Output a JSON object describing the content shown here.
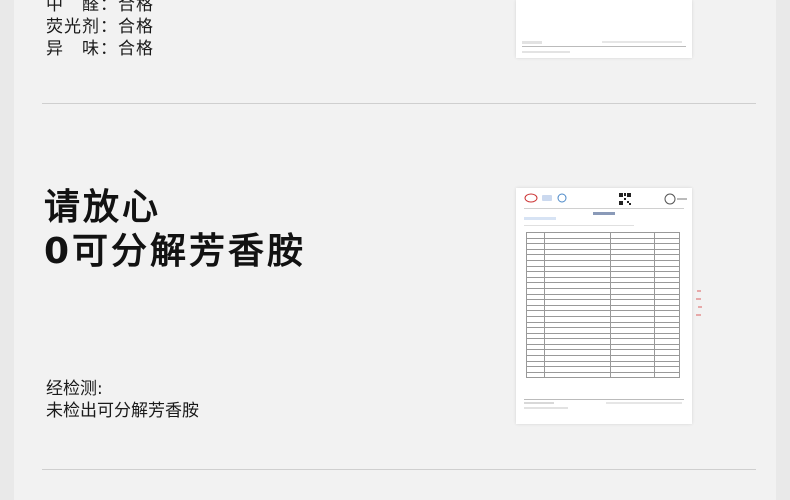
{
  "top_results": [
    {
      "label": "中　醛",
      "value": "合格"
    },
    {
      "label": "荧光剂",
      "value": "合格"
    },
    {
      "label": "异　味",
      "value": "合格"
    }
  ],
  "headline": {
    "line1": "请放心",
    "line2": "0可分解芳香胺"
  },
  "detected": {
    "line1": "经检测:",
    "line2": "未检出可分解芳香胺"
  },
  "colors": {
    "background": "#f2f2f2",
    "text": "#111111",
    "divider": "#cfcfcf"
  }
}
